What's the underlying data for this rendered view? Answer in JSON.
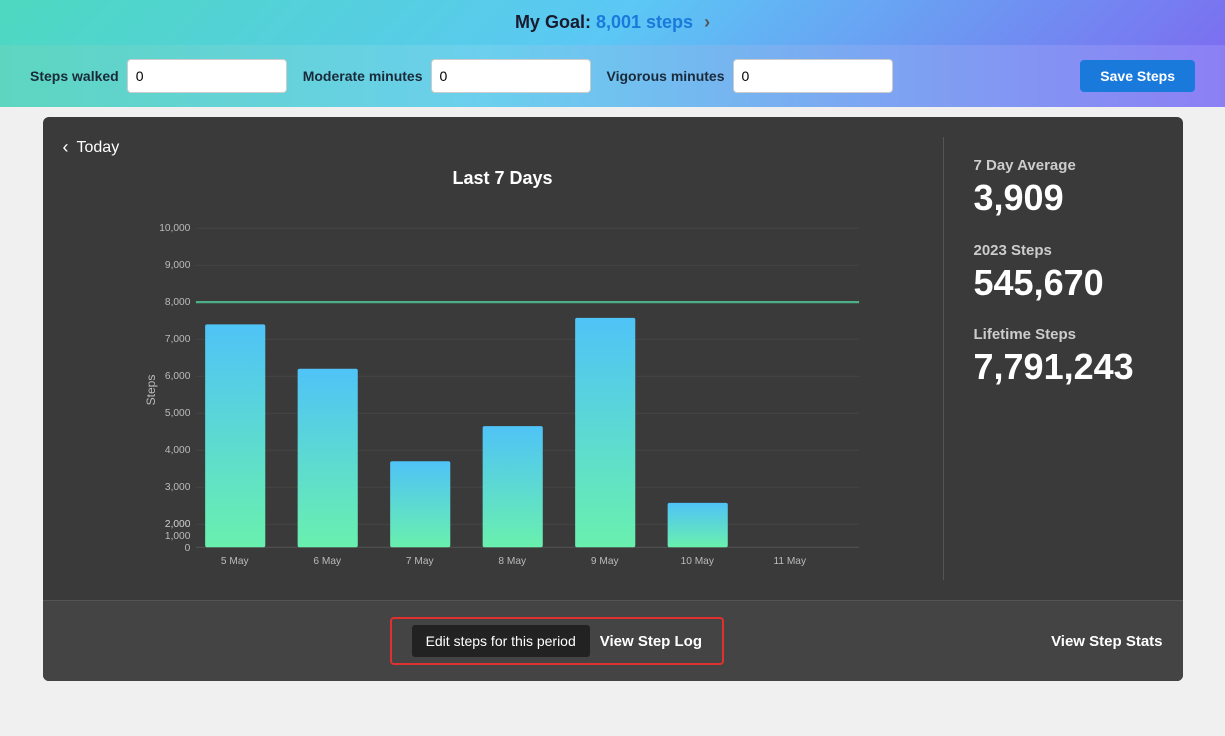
{
  "goal_bar": {
    "label": "My Goal:",
    "value": "8,001 steps",
    "chevron": "›"
  },
  "inputs": {
    "steps_walked_label": "Steps walked",
    "steps_walked_value": "0",
    "moderate_minutes_label": "Moderate minutes",
    "moderate_minutes_value": "0",
    "vigorous_minutes_label": "Vigorous minutes",
    "vigorous_minutes_value": "0",
    "save_button": "Save Steps"
  },
  "chart": {
    "nav_back": "‹",
    "nav_label": "Today",
    "title": "Last 7 Days",
    "y_axis_labels": [
      "10,000",
      "9,000",
      "8,000",
      "7,000",
      "6,000",
      "5,000",
      "4,000",
      "3,000",
      "2,000",
      "1,000",
      "0"
    ],
    "x_axis_labels": [
      "5 May",
      "6 May",
      "7 May",
      "8 May",
      "9 May",
      "10 May",
      "11 May"
    ],
    "goal_line_value": 8001,
    "y_max": 10000,
    "bars": [
      {
        "label": "5 May",
        "value": 7000
      },
      {
        "label": "6 May",
        "value": 5600
      },
      {
        "label": "7 May",
        "value": 2700
      },
      {
        "label": "8 May",
        "value": 3800
      },
      {
        "label": "9 May",
        "value": 7200
      },
      {
        "label": "10 May",
        "value": 1400
      },
      {
        "label": "11 May",
        "value": 0
      }
    ],
    "y_axis_title": "Steps"
  },
  "stats": {
    "avg_label": "7 Day Average",
    "avg_value": "3,909",
    "year_label": "2023 Steps",
    "year_value": "545,670",
    "lifetime_label": "Lifetime Steps",
    "lifetime_value": "7,791,243"
  },
  "bottom": {
    "edit_steps": "Edit steps for this period",
    "view_step_log": "View Step Log",
    "view_step_stats": "View Step Stats"
  }
}
